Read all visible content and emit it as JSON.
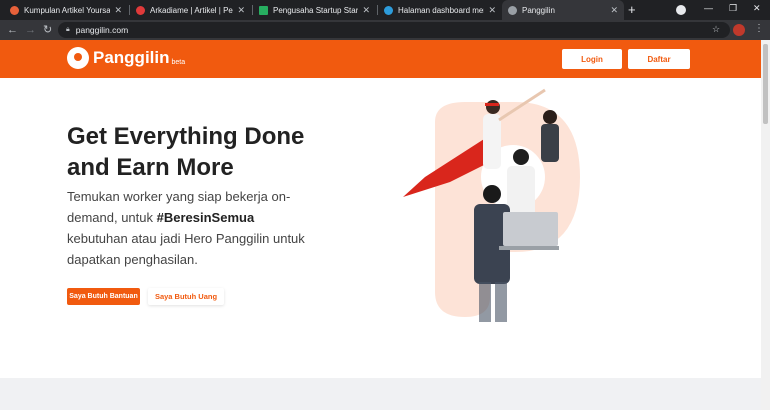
{
  "browser": {
    "tabs": [
      {
        "title": "Kumpulan Artikel Yoursay.id",
        "favicon_color": "#e8613a"
      },
      {
        "title": "Arkadiame | Artikel | Pending",
        "favicon_color": "#e03a3a"
      },
      {
        "title": "Pengusaha Startup Start-Up",
        "favicon_color": "#27ae60"
      },
      {
        "title": "Halaman dashboard menulis",
        "favicon_color": "#2d9cdb"
      },
      {
        "title": "Panggilin",
        "favicon_color": "#9aa0a6"
      }
    ],
    "url": "panggilin.com"
  },
  "site": {
    "brand": "Panggilin",
    "brand_tag": "beta",
    "login_label": "Login",
    "register_label": "Daftar",
    "accent_color": "#f15a0f"
  },
  "hero": {
    "title_line1": "Get Everything Done",
    "title_line2": "and Earn More",
    "desc_pre": "Temukan worker yang siap bekerja on-demand, untuk ",
    "desc_hashtag": "#BeresinSemua",
    "desc_post": " kebutuhan atau jadi Hero Panggilin untuk dapatkan penghasilan.",
    "cta_primary": "Saya Butuh Bantuan",
    "cta_secondary": "Saya Butuh Uang"
  }
}
